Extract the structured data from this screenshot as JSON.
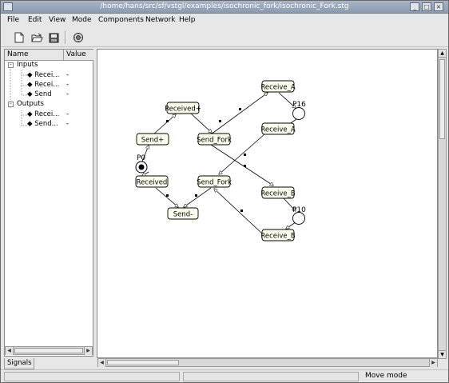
{
  "window": {
    "title": "/home/hans/src/sf/vstgl/examples/isochronic_fork/isochronic_Fork.stg"
  },
  "menu": {
    "file": "File",
    "edit": "Edit",
    "view": "View",
    "mode": "Mode",
    "components": "Components",
    "network": "Network",
    "help": "Help"
  },
  "toolbar": {
    "new_icon": "new-document-icon",
    "open_icon": "open-folder-icon",
    "save_icon": "save-disk-icon",
    "network_icon": "network-icon"
  },
  "signals_panel": {
    "col_name": "Name",
    "col_value": "Value",
    "inputs_label": "Inputs",
    "outputs_label": "Outputs",
    "inputs": [
      {
        "name": "Recei...",
        "value": "-"
      },
      {
        "name": "Recei...",
        "value": "-"
      },
      {
        "name": "Send",
        "value": "-"
      }
    ],
    "outputs": [
      {
        "name": "Recei...",
        "value": "-"
      },
      {
        "name": "Send...",
        "value": "-"
      }
    ],
    "tab_label": "Signals"
  },
  "graph": {
    "transitions": {
      "receive_a_top": "Receive_A",
      "received_plus": "Received+",
      "send_fork_top": "Send_Fork",
      "send_plus": "Send+",
      "receive_a_mid": "Receive_A",
      "received_minus": "Received",
      "send_fork_bottom": "Send_Fork",
      "receive_b_top": "Receive_B",
      "send_minus": "Send-",
      "receive_b_bottom": "Receive_B"
    },
    "places": {
      "p16": "P16",
      "p0": "P0",
      "p10": "P10"
    }
  },
  "status": {
    "mode": "Move mode"
  },
  "colors": {
    "titlebar": "#9aa6ba",
    "node_fill": "#fffff0",
    "canvas": "#ffffff"
  }
}
